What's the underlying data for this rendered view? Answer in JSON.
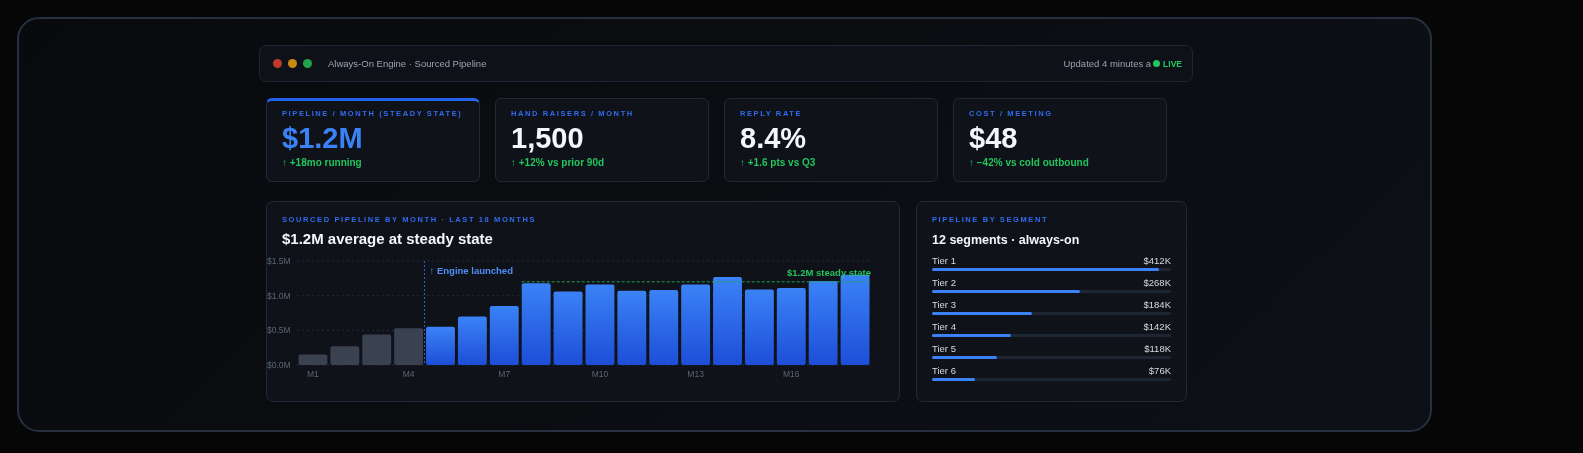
{
  "window": {
    "title": "Always-On Engine · Sourced Pipeline",
    "updated": "Updated 4 minutes a",
    "live": "LIVE"
  },
  "kpis": [
    {
      "label": "PIPELINE / MONTH (STEADY STATE)",
      "value": "$1.2M",
      "delta": "↑ +18mo running",
      "selected": true
    },
    {
      "label": "HAND RAISERS / MONTH",
      "value": "1,500",
      "delta": "↑ +12% vs prior 90d",
      "selected": false
    },
    {
      "label": "REPLY RATE",
      "value": "8.4%",
      "delta": "↑ +1.6 pts vs Q3",
      "selected": false
    },
    {
      "label": "COST / MEETING",
      "value": "$48",
      "delta": "↑ −42% vs cold outbound",
      "selected": false
    }
  ],
  "pipeline_chart": {
    "eyebrow": "SOURCED PIPELINE BY MONTH · LAST 18 MONTHS",
    "title": "$1.2M average at steady state",
    "chart_data": {
      "type": "bar",
      "stacked": true,
      "categories": [
        "M1",
        null,
        null,
        "M4",
        null,
        null,
        "M7",
        null,
        null,
        "M10",
        null,
        null,
        "M13",
        null,
        null,
        "M16",
        null,
        null
      ],
      "series": [
        {
          "color": "#3a4252",
          "values": [
            0.15,
            0.27,
            0.44,
            0.53,
            null,
            null,
            null,
            null,
            null,
            null,
            null,
            null,
            null,
            null,
            null,
            null,
            null,
            null
          ]
        },
        {
          "color": "#3b82f6",
          "values": [
            null,
            null,
            null,
            null,
            0.55,
            0.7,
            0.85,
            1.18,
            1.06,
            1.16,
            1.07,
            1.08,
            1.16,
            1.27,
            1.09,
            1.11,
            1.21,
            1.3
          ]
        }
      ],
      "ylim": [
        0,
        1.5
      ],
      "yticks": [
        {
          "value": 0,
          "label": "$0.0M"
        },
        {
          "value": 0.5,
          "label": "$0.5M"
        },
        {
          "value": 1.0,
          "label": "$1.0M"
        },
        {
          "value": 1.5,
          "label": "$1.5M"
        }
      ],
      "annotations": [
        "↑ Engine launched",
        {
          "text": "$1.2M steady state",
          "y": 1.2
        }
      ]
    }
  },
  "segments": {
    "eyebrow": "PIPELINE BY SEGMENT",
    "title": "12 segments · always-on",
    "rows": [
      {
        "name": "Tier 1",
        "amount": "$412K",
        "level": 0.95
      },
      {
        "name": "Tier 2",
        "amount": "$268K",
        "level": 0.62
      },
      {
        "name": "Tier 3",
        "amount": "$184K",
        "level": 0.42
      },
      {
        "name": "Tier 4",
        "amount": "$142K",
        "level": 0.33
      },
      {
        "name": "Tier 5",
        "amount": "$118K",
        "level": 0.27
      },
      {
        "name": "Tier 6",
        "amount": "$76K",
        "level": 0.18
      }
    ]
  }
}
